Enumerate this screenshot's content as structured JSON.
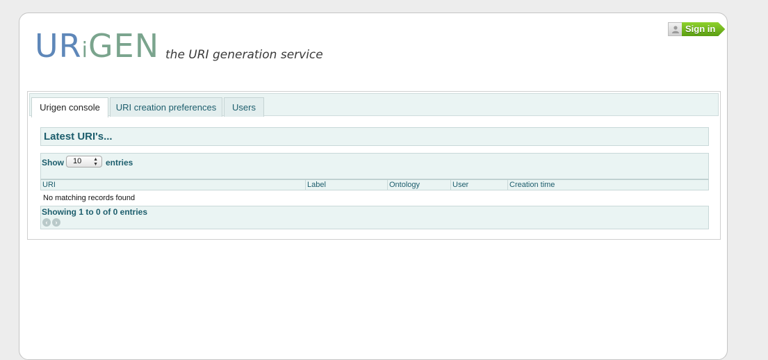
{
  "header": {
    "logo": {
      "part1": "UR",
      "part2": "i",
      "part3": "GEN"
    },
    "tagline": "the URI generation service",
    "signin_label": "Sign in"
  },
  "tabs": [
    {
      "label": "Urigen console",
      "active": true
    },
    {
      "label": "URI creation preferences",
      "active": false
    },
    {
      "label": "Users",
      "active": false
    }
  ],
  "console": {
    "section_title": "Latest URI's...",
    "length_control": {
      "show_label": "Show",
      "selected": "10",
      "entries_label": "entries"
    },
    "columns": [
      "URI",
      "Label",
      "Ontology",
      "User",
      "Creation time"
    ],
    "empty_message": "No matching records found",
    "info": "Showing 1 to 0 of 0 entries"
  },
  "icons": {
    "signin_avatar": "user-icon",
    "pager_prev": "arrow-left-icon",
    "pager_next": "arrow-right-icon"
  },
  "colors": {
    "teal_text": "#1c5d6c",
    "panel_bg": "#eaf4f3",
    "signin_green": "#6fb81c",
    "logo_blue": "#5e87b9",
    "logo_green": "#7aa48d"
  }
}
